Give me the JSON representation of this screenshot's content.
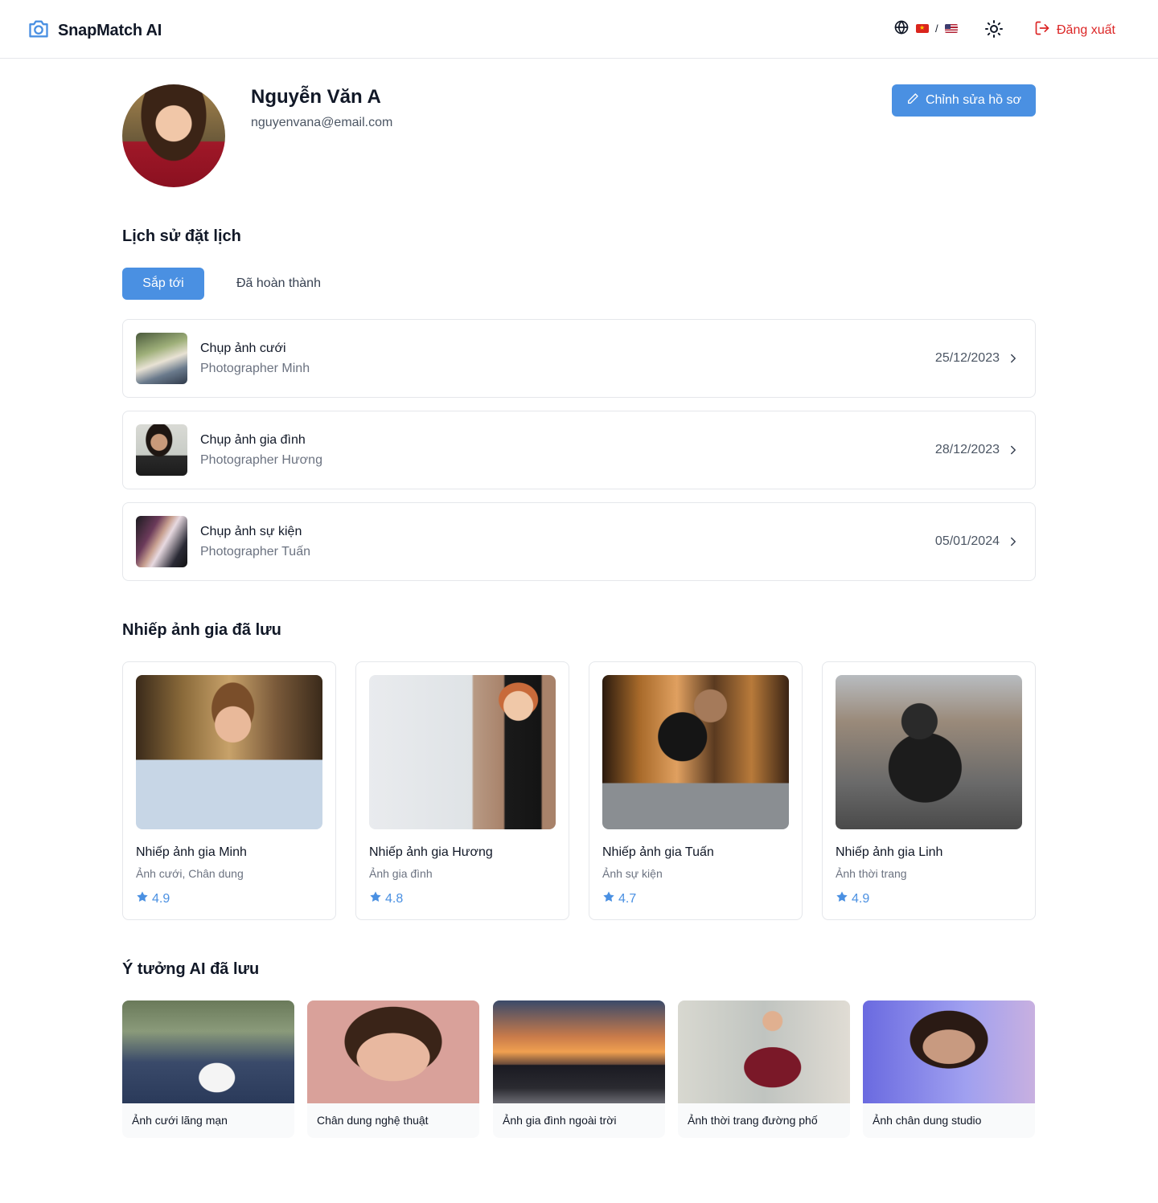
{
  "header": {
    "brand": "SnapMatch AI",
    "lang_separator": "/",
    "logout_label": "Đăng xuất",
    "accent_color": "#4a90e2",
    "danger_color": "#dc2626"
  },
  "profile": {
    "name": "Nguyễn Văn A",
    "email": "nguyenvana@email.com",
    "edit_label": "Chỉnh sửa hồ sơ"
  },
  "bookings": {
    "title": "Lịch sử đặt lịch",
    "tabs": [
      {
        "label": "Sắp tới",
        "active": true
      },
      {
        "label": "Đã hoàn thành",
        "active": false
      }
    ],
    "items": [
      {
        "title": "Chụp ảnh cưới",
        "photographer": "Photographer Minh",
        "date": "25/12/2023"
      },
      {
        "title": "Chụp ảnh gia đình",
        "photographer": "Photographer Hương",
        "date": "28/12/2023"
      },
      {
        "title": "Chụp ảnh sự kiện",
        "photographer": "Photographer Tuấn",
        "date": "05/01/2024"
      }
    ]
  },
  "saved_photographers": {
    "title": "Nhiếp ảnh gia đã lưu",
    "items": [
      {
        "name": "Nhiếp ảnh gia Minh",
        "specialty": "Ảnh cưới, Chân dung",
        "rating": "4.9"
      },
      {
        "name": "Nhiếp ảnh gia Hương",
        "specialty": "Ảnh gia đình",
        "rating": "4.8"
      },
      {
        "name": "Nhiếp ảnh gia Tuấn",
        "specialty": "Ảnh sự kiện",
        "rating": "4.7"
      },
      {
        "name": "Nhiếp ảnh gia Linh",
        "specialty": "Ảnh thời trang",
        "rating": "4.9"
      }
    ]
  },
  "saved_ideas": {
    "title": "Ý tưởng AI đã lưu",
    "items": [
      {
        "label": "Ảnh cưới lãng mạn"
      },
      {
        "label": "Chân dung nghệ thuật"
      },
      {
        "label": "Ảnh gia đình ngoài trời"
      },
      {
        "label": "Ảnh thời trang đường phố"
      },
      {
        "label": "Ảnh chân dung studio"
      }
    ]
  }
}
